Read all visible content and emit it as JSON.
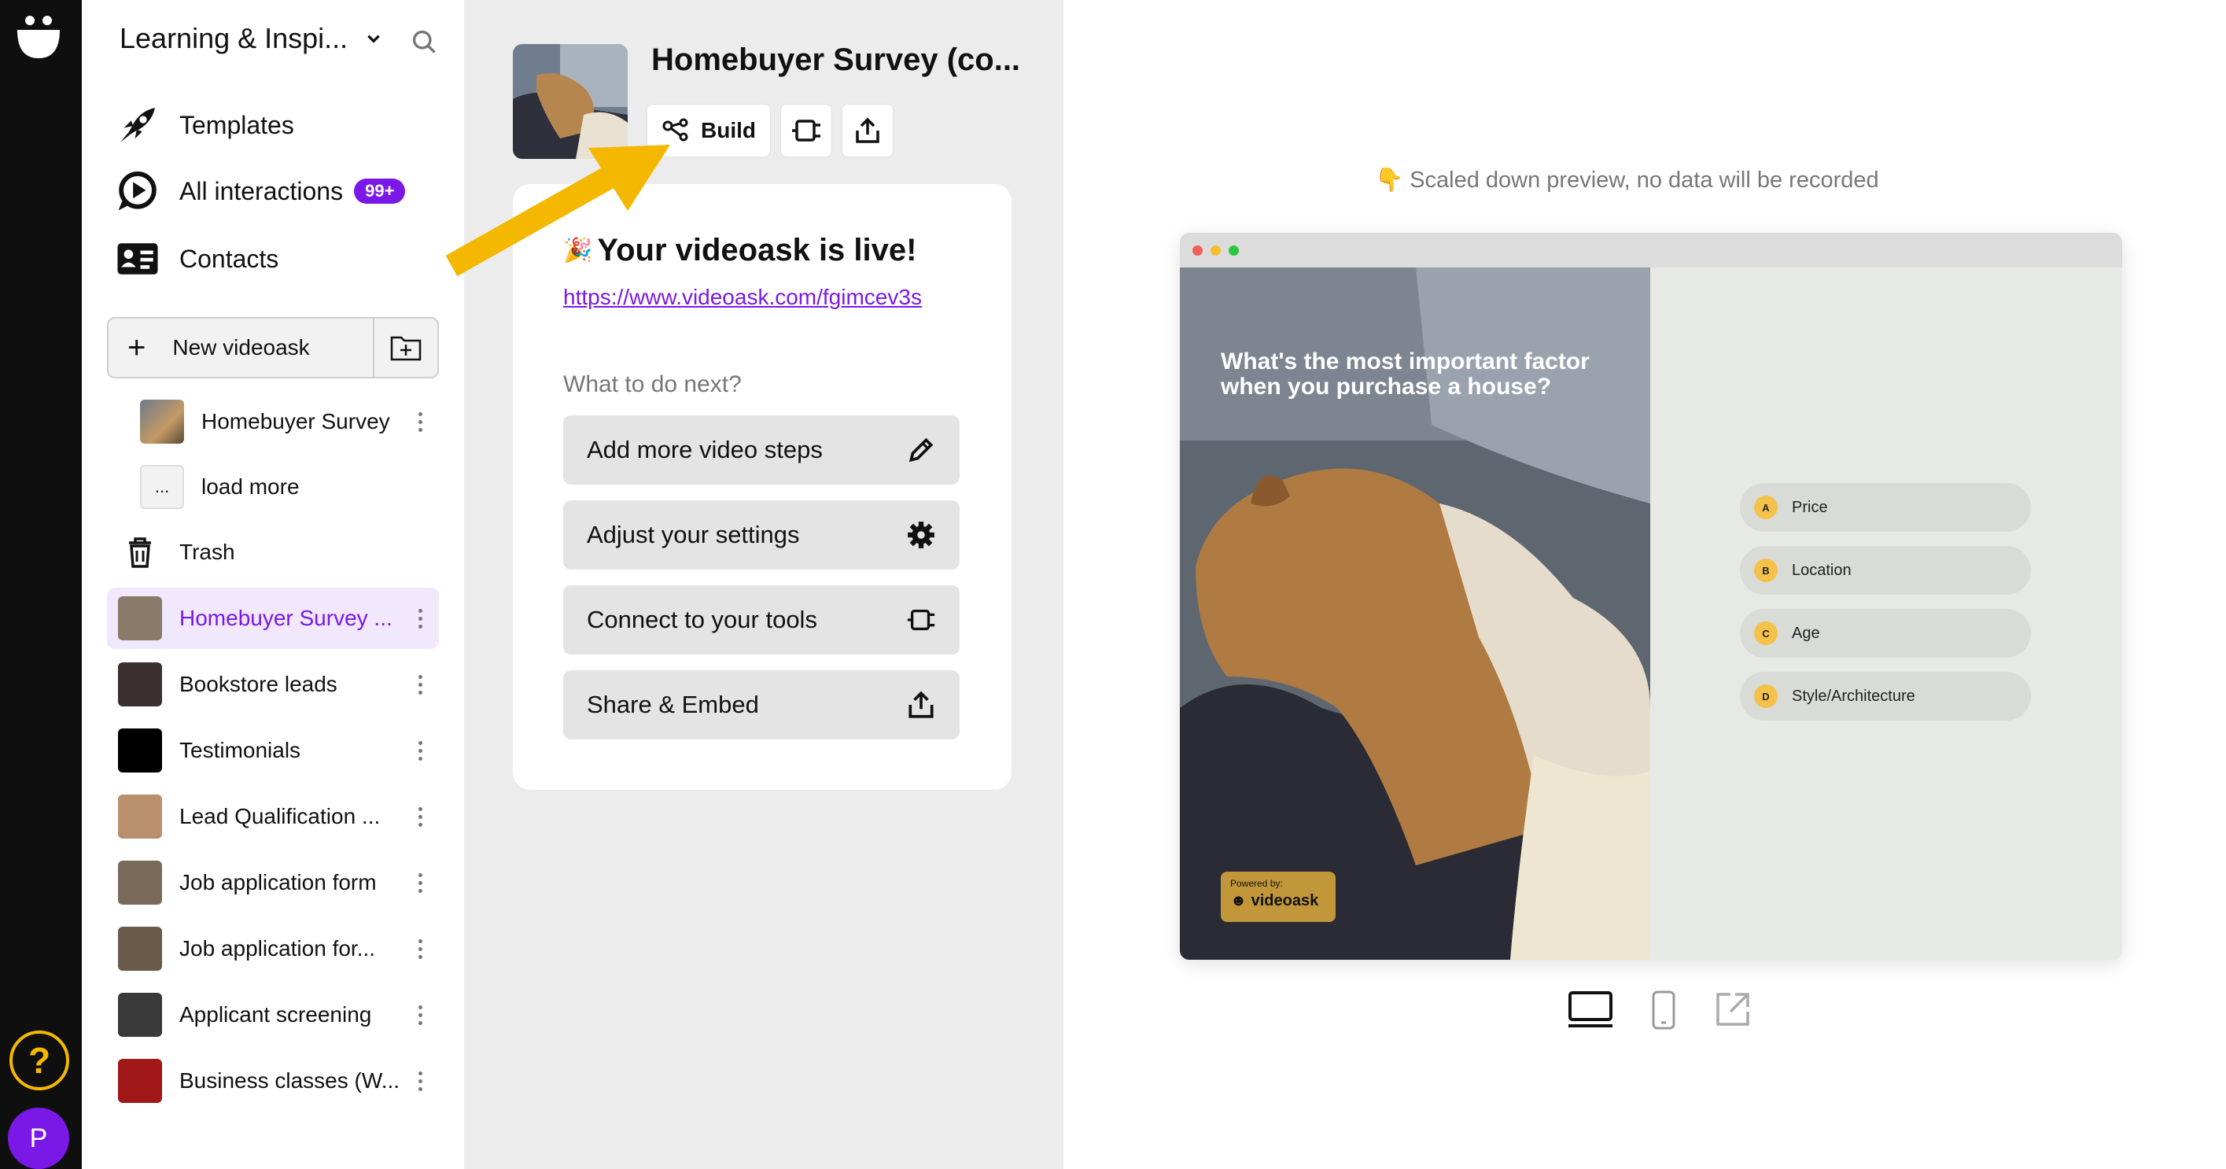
{
  "workspace": {
    "name": "Learning & Inspi...",
    "dropdown_icon": "chevron-down-icon",
    "search_icon": "search-icon"
  },
  "nav": [
    {
      "label": "Templates",
      "icon": "rocket-icon"
    },
    {
      "label": "All interactions",
      "icon": "play-bubble-icon",
      "badge": "99+"
    },
    {
      "label": "Contacts",
      "icon": "contacts-card-icon"
    }
  ],
  "new_videoask": {
    "label": "New videoask",
    "folder_icon": "new-folder-icon"
  },
  "folder_items": [
    {
      "label": "Homebuyer Survey"
    },
    {
      "label": "load more",
      "thumb_text": "..."
    }
  ],
  "trash": {
    "label": "Trash"
  },
  "videoasks": [
    {
      "label": "Homebuyer Survey ...",
      "active": true,
      "thumb_color": "#8a7a6a"
    },
    {
      "label": "Bookstore leads",
      "thumb_color": "#3a3030"
    },
    {
      "label": "Testimonials",
      "thumb_color": "#000000"
    },
    {
      "label": "Lead Qualification ...",
      "thumb_color": "#b8906c"
    },
    {
      "label": "Job application form",
      "thumb_color": "#7a6a5a"
    },
    {
      "label": "Job application for...",
      "thumb_color": "#6a5a4a"
    },
    {
      "label": "Applicant screening",
      "thumb_color": "#3a3a3a"
    },
    {
      "label": "Business classes (W...",
      "thumb_color": "#a01818"
    }
  ],
  "rail": {
    "help": "?",
    "avatar": "P"
  },
  "survey": {
    "title": "Homebuyer Survey (co...",
    "build_label": "Build"
  },
  "live_card": {
    "emoji": "🎉",
    "title": "Your videoask is live!",
    "url": "https://www.videoask.com/fgimcev3s",
    "next_label": "What to do next?",
    "actions": [
      {
        "label": "Add more video steps",
        "icon": "pencil-icon"
      },
      {
        "label": "Adjust your settings",
        "icon": "gear-icon"
      },
      {
        "label": "Connect to your tools",
        "icon": "connector-icon"
      },
      {
        "label": "Share & Embed",
        "icon": "share-icon"
      }
    ]
  },
  "preview": {
    "note": "👇 Scaled down preview, no data will be recorded",
    "question": "What's the most important factor when you purchase a house?",
    "powered_by": "Powered by:",
    "brand": "videoask",
    "choices": [
      {
        "letter": "A",
        "label": "Price"
      },
      {
        "letter": "B",
        "label": "Location"
      },
      {
        "letter": "C",
        "label": "Age"
      },
      {
        "letter": "D",
        "label": "Style/Architecture"
      }
    ],
    "devices": [
      "desktop-icon",
      "mobile-icon",
      "external-link-icon"
    ]
  },
  "colors": {
    "accent": "#7a18e8",
    "arrow": "#f5b800",
    "rail": "#0f0f0f"
  }
}
